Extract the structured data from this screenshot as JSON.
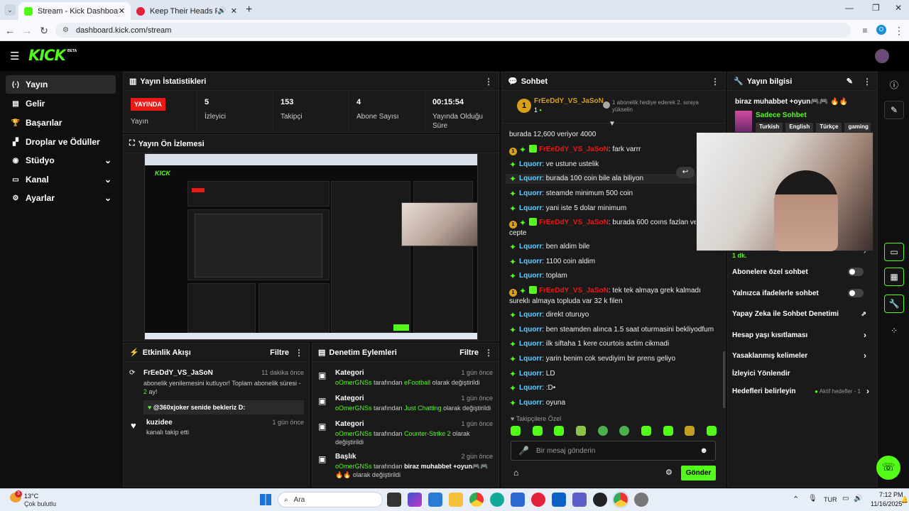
{
  "browser": {
    "tabs": [
      {
        "title": "Stream - Kick Dashboard",
        "active": true
      },
      {
        "title": "Keep Their Heads Ringin' -",
        "active": false
      }
    ],
    "url": "dashboard.kick.com/stream",
    "profile_initial": "O"
  },
  "kick": {
    "logo": "KICK",
    "beta": "BETA"
  },
  "sidebar": {
    "items": [
      {
        "label": "Yayın",
        "icon": "broadcast-icon",
        "glyph": "(·)"
      },
      {
        "label": "Gelir",
        "icon": "revenue-icon",
        "glyph": "▤"
      },
      {
        "label": "Başarılar",
        "icon": "trophy-icon",
        "glyph": "🏆"
      },
      {
        "label": "Droplar ve Ödüller",
        "icon": "drops-icon",
        "glyph": "▞"
      },
      {
        "label": "Stüdyo",
        "icon": "studio-icon",
        "glyph": "◉"
      },
      {
        "label": "Kanal",
        "icon": "channel-icon",
        "glyph": "▭"
      },
      {
        "label": "Ayarlar",
        "icon": "gear-icon",
        "glyph": "⚙"
      }
    ]
  },
  "stats": {
    "title": "Yayın İstatistikleri",
    "live_badge": "YAYINDA",
    "live_label": "Yayın",
    "cells": [
      {
        "value": "5",
        "label": "İzleyici"
      },
      {
        "value": "153",
        "label": "Takipçi"
      },
      {
        "value": "4",
        "label": "Abone Sayısı"
      },
      {
        "value": "00:15:54",
        "label": "Yayında Olduğu Süre"
      }
    ]
  },
  "preview": {
    "title": "Yayın Ön İzlemesi"
  },
  "activity": {
    "title": "Etkinlik Akışı",
    "filter": "Filtre",
    "items": [
      {
        "user": "FrEeDdY_VS_JaSoN",
        "time": "11 dakika önce",
        "text_a": "abonelik yenilemesini kutluyor! Toplam abonelik süresi - ",
        "highlight": "2",
        "text_b": " ay!",
        "quote": "@360xjoker senide bekleriz D:"
      },
      {
        "user": "kuzidee",
        "time": "1 gün önce",
        "text_a": "kanalı takip etti"
      }
    ]
  },
  "moderation": {
    "title": "Denetim Eylemleri",
    "filter": "Filtre",
    "items": [
      {
        "title": "Kategori",
        "time": "1 gün önce",
        "user": "oOmerGNSs",
        "mid": " tarafından ",
        "value": "eFootball",
        "tail": " olarak değiştirildi"
      },
      {
        "title": "Kategori",
        "time": "1 gün önce",
        "user": "oOmerGNSs",
        "mid": " tarafından ",
        "value": "Just Chatting",
        "tail": " olarak değiştirildi"
      },
      {
        "title": "Kategori",
        "time": "1 gün önce",
        "user": "oOmerGNSs",
        "mid": " tarafından ",
        "value": "Counter-Strike 2",
        "tail": " olarak değiştirildi"
      },
      {
        "title": "Başlık",
        "time": "2 gün önce",
        "user": "oOmerGNSs",
        "mid": " tarafından ",
        "value": "biraz muhabbet +oyun🎮🎮 🔥🔥",
        "tail": " olarak değiştirildi"
      }
    ]
  },
  "chat": {
    "title": "Sohbet",
    "pinned_user": "FrEeDdY_VS_JaSoN",
    "pinned_count": "1",
    "pinned_note": "1 abonelik hediye ederek 2. sıraya yükselin",
    "messages": [
      {
        "user": "",
        "text": "burada 12,600 veriyor 4000",
        "badges": []
      },
      {
        "user": "FrEeDdY_VS_JaSoN",
        "text": ": fark varrr",
        "badges": [
          "1",
          "spark",
          "gift"
        ],
        "red": true
      },
      {
        "user": "Lquorr",
        "text": ": ve ustune ustelik",
        "badges": [
          "spark"
        ]
      },
      {
        "user": "Lquorr",
        "text": ": burada 100 coin bile ala biliyon",
        "badges": [
          "spark"
        ]
      },
      {
        "user": "Lquorr",
        "text": ": steamde minimum 500 coin",
        "badges": [
          "spark"
        ]
      },
      {
        "user": "Lquorr",
        "text": ": yani iste 5 dolar minimum",
        "badges": [
          "spark"
        ]
      },
      {
        "user": "FrEeDdY_VS_JaSoN",
        "text": ": burada 600 coıns fazlan ve 4000 cepte",
        "badges": [
          "1",
          "spark",
          "gift"
        ],
        "red": true
      },
      {
        "user": "Lquorr",
        "text": ": ben aldim bile",
        "badges": [
          "spark"
        ]
      },
      {
        "user": "Lquorr",
        "text": ": 1100 coin aldim",
        "badges": [
          "spark"
        ]
      },
      {
        "user": "Lquorr",
        "text": ": toplam",
        "badges": [
          "spark"
        ]
      },
      {
        "user": "FrEeDdY_VS_JaSoN",
        "text": ": tek tek almaya grek kalmadı sureklı almaya topluda var 32 k filen",
        "badges": [
          "1",
          "spark",
          "gift"
        ],
        "red": true
      },
      {
        "user": "Lquorr",
        "text": ": direkt oturuyo",
        "badges": [
          "spark"
        ]
      },
      {
        "user": "Lquorr",
        "text": ": ben steamden alınca 1.5 saat oturmasini bekliyodfum",
        "badges": [
          "spark"
        ]
      },
      {
        "user": "Lquorr",
        "text": ": ilk siftaha 1 kere courtois actim cikmadi",
        "badges": [
          "spark"
        ]
      },
      {
        "user": "Lquorr",
        "text": ": yarin benim cok sevdiyim bir prens geliyo",
        "badges": [
          "spark"
        ]
      },
      {
        "user": "Lquorr",
        "text": ": LD",
        "badges": [
          "spark"
        ]
      },
      {
        "user": "Lquorr",
        "text": ": :D•",
        "badges": [
          "spark"
        ]
      },
      {
        "user": "Lquorr",
        "text": ": oyuna",
        "badges": [
          "spark"
        ]
      }
    ],
    "followers_only": "Takipçilere Özel",
    "input_placeholder": "Bir mesaj gönderin",
    "send": "Gönder"
  },
  "info": {
    "title": "Yayın bilgisi",
    "stream_title": "biraz muhabbet +oyun🎮🎮 🔥🔥",
    "category": "Sadece Sohbet",
    "tags": [
      "Turkish",
      "English",
      "Türkçe",
      "gaming"
    ],
    "slow_value": "1 dk.",
    "settings": [
      {
        "label": "Abonelere özel sohbet",
        "kind": "toggle"
      },
      {
        "label": "Yalnızca ifadelerle sohbet",
        "kind": "toggle"
      },
      {
        "label": "Yapay Zeka ile Sohbet Denetimi",
        "kind": "external"
      },
      {
        "label": "Hesap yaşı kısıtlaması",
        "kind": "chevron"
      },
      {
        "label": "Yasaklanmış kelimeler",
        "kind": "chevron"
      },
      {
        "label": "İzleyici Yönlendir",
        "kind": "none"
      },
      {
        "label": "Hedefleri belirleyin",
        "kind": "goals",
        "extra": "Aktif hedefler - 1"
      }
    ]
  },
  "taskbar": {
    "weather_temp": "13°C",
    "weather_desc": "Çok bulutlu",
    "search": "Ara",
    "lang": "TUR",
    "time": "7:12 PM",
    "date": "11/16/2025",
    "weather_badge": "3"
  },
  "colors": {
    "accent": "#53fc18",
    "live": "#e91916",
    "panel": "#1a1a1a"
  }
}
